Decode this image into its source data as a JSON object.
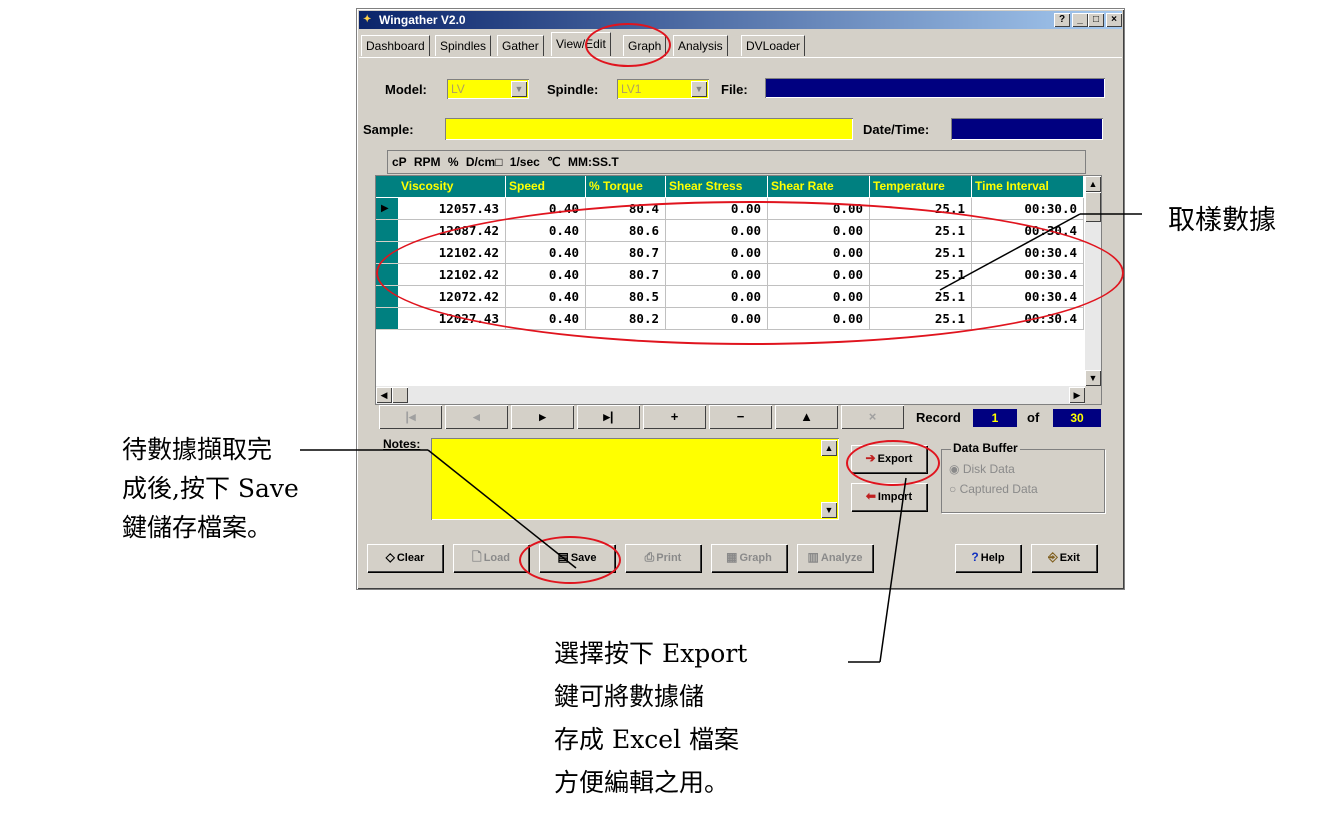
{
  "window": {
    "title": "Wingather V2.0",
    "buttons": [
      "?",
      "_",
      "□",
      "×"
    ]
  },
  "tabs": [
    "Dashboard",
    "Spindles",
    "Gather",
    "View/Edit",
    "Graph",
    "Analysis",
    "DVLoader"
  ],
  "active_tab": "View/Edit",
  "fields": {
    "model_label": "Model:",
    "model_value": "LV",
    "spindle_label": "Spindle:",
    "spindle_value": "LV1",
    "file_label": "File:",
    "sample_label": "Sample:",
    "datetime_label": "Date/Time:"
  },
  "units_bar": [
    "cP",
    "RPM",
    "%",
    "D/cm□",
    "1/sec",
    "℃",
    "MM:SS.T"
  ],
  "table": {
    "columns": [
      "Viscosity",
      "Speed",
      "% Torque",
      "Shear Stress",
      "Shear Rate",
      "Temperature",
      "Time Interval"
    ],
    "rows": [
      [
        "12057.43",
        "0.40",
        "80.4",
        "0.00",
        "0.00",
        "25.1",
        "00:30.0"
      ],
      [
        "12087.42",
        "0.40",
        "80.6",
        "0.00",
        "0.00",
        "25.1",
        "00:30.4"
      ],
      [
        "12102.42",
        "0.40",
        "80.7",
        "0.00",
        "0.00",
        "25.1",
        "00:30.4"
      ],
      [
        "12102.42",
        "0.40",
        "80.7",
        "0.00",
        "0.00",
        "25.1",
        "00:30.4"
      ],
      [
        "12072.42",
        "0.40",
        "80.5",
        "0.00",
        "0.00",
        "25.1",
        "00:30.4"
      ],
      [
        "12027.43",
        "0.40",
        "80.2",
        "0.00",
        "0.00",
        "25.1",
        "00:30.4"
      ]
    ]
  },
  "navigator": {
    "buttons": [
      "|◂",
      "◂",
      "▸",
      "▸|",
      "+",
      "−",
      "▲",
      "×"
    ],
    "record_label": "Record",
    "record_value": "1",
    "of_label": "of",
    "total_value": "30"
  },
  "notes_label": "Notes:",
  "export_label": "Export",
  "import_label": "Import",
  "data_buffer": {
    "title": "Data Buffer",
    "options": [
      "Disk Data",
      "Captured Data"
    ]
  },
  "bottom_buttons": {
    "clear": "Clear",
    "load": "Load",
    "save": "Save",
    "print": "Print",
    "graph": "Graph",
    "analyze": "Analyze",
    "help": "Help",
    "exit": "Exit"
  },
  "annotations": {
    "right": "取樣數據",
    "left": [
      "待數據擷取完",
      "成後,按下 Save",
      "鍵儲存檔案。"
    ],
    "bottom": [
      "選擇按下 Export",
      "鍵可將數據儲",
      "存成 Excel 檔案",
      "方便編輯之用。"
    ]
  },
  "colors": {
    "highlight": "#e0141e",
    "grid_header": "#008080",
    "field_yellow": "#ffff00",
    "navy": "#000080"
  }
}
